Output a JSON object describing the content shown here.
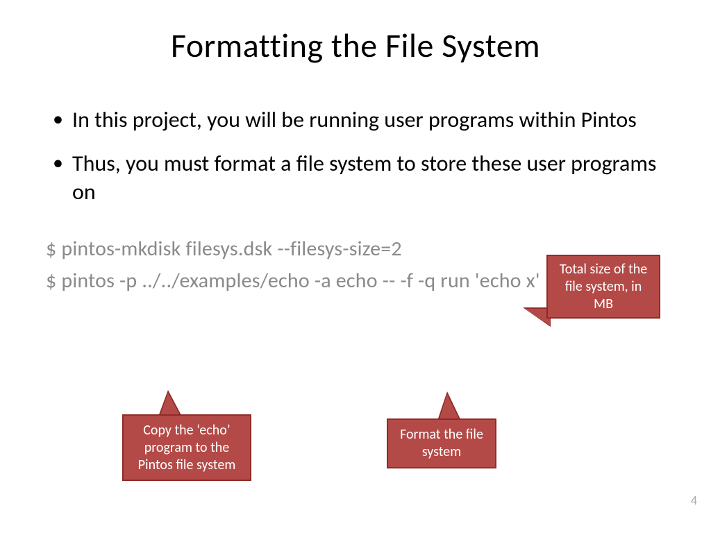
{
  "title": "Formatting the File System",
  "bullets": [
    "In this project, you will be running user programs within Pintos",
    "Thus, you must format a file system to store these user programs on"
  ],
  "commands": [
    "$ pintos-mkdisk filesys.dsk --filesys-size=2",
    "$ pintos -p ../../examples/echo -a echo -- -f -q run 'echo x'"
  ],
  "callouts": {
    "total": "Total size of the file system, in MB",
    "copy": "Copy the ‘echo’ program to the Pintos file system",
    "format": "Format  the file system"
  },
  "page_number": "4"
}
